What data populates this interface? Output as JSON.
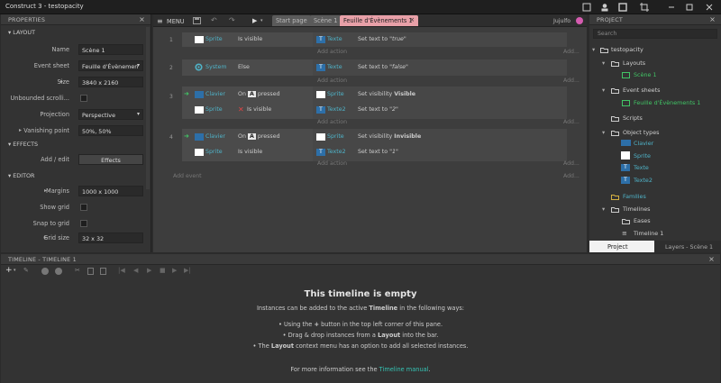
{
  "window": {
    "title": "Construct 3 - testopacity"
  },
  "properties": {
    "header": "PROPERTIES",
    "sections": {
      "layout": "LAYOUT",
      "effects": "EFFECTS",
      "editor": "EDITOR"
    },
    "layout_rows": [
      {
        "label": "Name",
        "value": "Scène 1"
      },
      {
        "label": "Event sheet",
        "value": "Feuille d'Évènemen"
      },
      {
        "label": "Size",
        "value": "3840 x 2160"
      },
      {
        "label": "Unbounded scrolli...",
        "value": ""
      },
      {
        "label": "Projection",
        "value": "Perspective"
      },
      {
        "label": "Vanishing point",
        "value": "50%, 50%"
      }
    ],
    "effects_rows": [
      {
        "label": "Add / edit",
        "value": "Effects"
      }
    ],
    "editor_rows": [
      {
        "label": "Margins",
        "value": "1000 x 1000"
      },
      {
        "label": "Show grid",
        "value": ""
      },
      {
        "label": "Snap to grid",
        "value": ""
      },
      {
        "label": "Grid size",
        "value": "32 x 32"
      }
    ]
  },
  "sheet": {
    "menu": "MENU",
    "tabs": [
      "Start page",
      "Scène 1",
      "Feuille d'Évènements 1"
    ],
    "user": "Jujulfo",
    "events": [
      {
        "num": "1",
        "conditions": [
          {
            "object": "Sprite",
            "text": "Is visible",
            "icon": "sprite-icon",
            "neg": false
          }
        ],
        "actions": [
          {
            "object": "Texte",
            "pre": "Set text to ",
            "italic": "\"true\"",
            "bold": ""
          }
        ],
        "add": "Add action"
      },
      {
        "num": "2",
        "conditions": [
          {
            "object": "System",
            "text": "Else",
            "icon": "system-gear-icon",
            "neg": false
          }
        ],
        "actions": [
          {
            "object": "Texte",
            "pre": "Set text to ",
            "italic": "\"false\"",
            "bold": ""
          }
        ],
        "add": "Add action"
      },
      {
        "num": "3",
        "conditions": [
          {
            "object": "Clavier",
            "text": "On  pressed",
            "key": "A",
            "icon": "keyboard-icon",
            "neg": false
          },
          {
            "object": "Sprite",
            "text": "Is visible",
            "icon": "sprite-icon",
            "neg": true
          }
        ],
        "actions": [
          {
            "object": "Sprite",
            "pre": "Set visibility ",
            "italic": "",
            "bold": "Visible"
          },
          {
            "object": "Texte2",
            "pre": "Set text to ",
            "italic": "\"2\"",
            "bold": ""
          }
        ],
        "add": "Add action"
      },
      {
        "num": "4",
        "conditions": [
          {
            "object": "Clavier",
            "text": "On  pressed",
            "key": "A",
            "icon": "keyboard-icon",
            "neg": false
          },
          {
            "object": "Sprite",
            "text": "Is visible",
            "icon": "sprite-icon",
            "neg": false
          }
        ],
        "actions": [
          {
            "object": "Sprite",
            "pre": "Set visibility ",
            "italic": "",
            "bold": "Invisible"
          },
          {
            "object": "Texte2",
            "pre": "Set text to ",
            "italic": "\"1\"",
            "bold": ""
          }
        ],
        "add": "Add action"
      }
    ],
    "add_event": "Add event",
    "add_short": "Add...",
    "add_action_short": "Add..."
  },
  "project": {
    "header": "PROJECT",
    "search_placeholder": "Search",
    "tree": [
      {
        "label": "testopacity"
      },
      {
        "label": "Layouts"
      },
      {
        "label": "Scène 1"
      },
      {
        "label": "Event sheets"
      },
      {
        "label": "Feuille d'Évènements 1"
      },
      {
        "label": "Scripts"
      },
      {
        "label": "Object types"
      },
      {
        "label": "Clavier"
      },
      {
        "label": "Sprite"
      },
      {
        "label": "Texte"
      },
      {
        "label": "Texte2"
      },
      {
        "label": "Families"
      },
      {
        "label": "Timelines"
      },
      {
        "label": "Eases"
      },
      {
        "label": "Timeline 1"
      }
    ],
    "bottom_tabs": [
      "Project",
      "Layers - Scène 1"
    ]
  },
  "timeline": {
    "header": "TIMELINE - TIMELINE 1",
    "empty_title": "This timeline is empty",
    "intro_pre": "Instances can be added to the active ",
    "intro_bold": "Timeline",
    "intro_post": " in the following ways:",
    "bullets": [
      {
        "pre": "Using the ",
        "bold": "+",
        "post": " button in the top left corner of this pane."
      },
      {
        "pre": "Drag & drop instances from a ",
        "bold": "Layout",
        "post": " into the bar."
      },
      {
        "pre": "The ",
        "bold": "Layout",
        "post": " context menu has an option to add all selected instances."
      }
    ],
    "footer_pre": "For more information see the ",
    "footer_link": "Timeline manual",
    "footer_post": "."
  },
  "colors": {
    "accent": "#e8a0a8",
    "link": "#35c4b5",
    "cyan": "#4fb3c8",
    "green": "#41c465"
  }
}
